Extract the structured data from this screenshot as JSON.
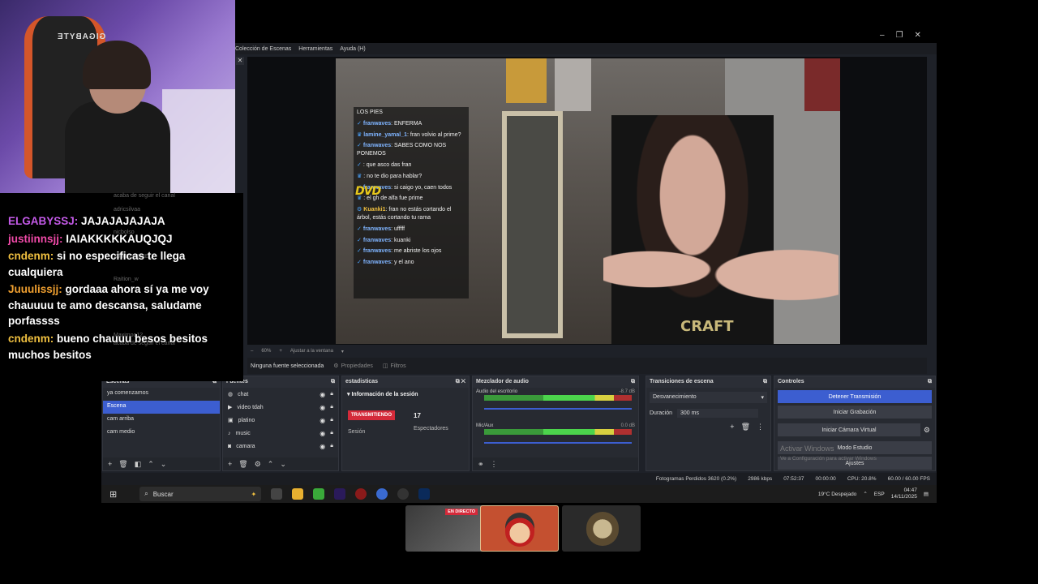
{
  "webcam": {
    "chair_brand": "GIGABYTE"
  },
  "window": {
    "controls": [
      "–",
      "❐",
      "✕"
    ]
  },
  "menubar": {
    "items": [
      "Colección de Escenas",
      "Herramientas",
      "Ayuda (H)"
    ]
  },
  "preview": {
    "overlay_chat": [
      {
        "user": "",
        "text": "LOS PIES",
        "style": ""
      },
      {
        "user": "franwaves",
        "text": ": ENFERMA",
        "style": ""
      },
      {
        "user": "lamine_yamal_1",
        "text": ": fran volvio al prime?",
        "style": "y"
      },
      {
        "user": "franwaves",
        "text": ": SABES COMO NOS PONEMOS",
        "style": ""
      },
      {
        "user": "",
        "text": ": que asco das fran",
        "style": "r"
      },
      {
        "user": "",
        "text": ": no te dio para hablar?",
        "style": "y"
      },
      {
        "user": "franwaves",
        "text": ": si caigo yo, caen todos",
        "style": ""
      },
      {
        "user": "",
        "text": ": el gh de alfa fue prime",
        "style": "r"
      },
      {
        "user": "Kuanki1",
        "text": ": fran no estás cortando el árbol, estás cortando tu rama",
        "style": "y"
      },
      {
        "user": "franwaves",
        "text": ": ufffff",
        "style": ""
      },
      {
        "user": "franwaves",
        "text": ": kuanki",
        "style": ""
      },
      {
        "user": "franwaves",
        "text": ": me abriste los ojos",
        "style": ""
      },
      {
        "user": "franwaves",
        "text": ": y el ano",
        "style": ""
      }
    ],
    "dvd_logo": "DVD",
    "shirt_text": "CRAFT",
    "zoom": "60%",
    "zoom_fit": "Ajustar a la ventana"
  },
  "sourcebar": {
    "status": "Ninguna fuente seleccionada",
    "properties": "Propiedades",
    "filters": "Filtros"
  },
  "scenes": {
    "title": "Escenas",
    "items": [
      "ya comenzamos",
      "Escena",
      "cam arriba",
      "cam medio"
    ],
    "selected": 1
  },
  "sources": {
    "title": "Fuentes",
    "items": [
      "chat",
      "video tdah",
      "platino",
      "music",
      "camara"
    ]
  },
  "stats": {
    "title": "estadisticas",
    "section": "Información de la sesión",
    "live_badge": "TRANSMITIENDO",
    "session_label": "Sesión",
    "viewers_count": "17",
    "viewers_label": "Espectadores"
  },
  "mixer": {
    "title": "Mezclador de audio",
    "channels": [
      {
        "name": "Audio del escritorio",
        "db": "-8.7 dB"
      },
      {
        "name": "Mic/Aux",
        "db": "0.0 dB"
      }
    ],
    "scale": "-60 -55 -50 -45 -40 -35 -30 -25 -20 -15 -10 -5 0"
  },
  "transitions": {
    "title": "Transiciones de escena",
    "type": "Desvanecimiento",
    "duration_label": "Duración",
    "duration_value": "300 ms"
  },
  "controls": {
    "title": "Controles",
    "buttons": [
      "Detener Transmisión",
      "Iniciar Grabación",
      "Iniciar Cámara Virtual",
      "Modo Estudio",
      "Ajustes"
    ]
  },
  "watermark": {
    "line1": "Activar Windows",
    "line2": "Ve a Configuración para activar Windows"
  },
  "statusbar": {
    "dropped": "Fotogramas Perdidos 3620 (0.2%)",
    "bitrate": "2986 kbps",
    "live_time": "07:52:37",
    "rec_time": "00:00:00",
    "cpu": "CPU: 20.8%",
    "fps": "60.00 / 60.00 FPS"
  },
  "taskbar": {
    "search": "Buscar",
    "weather": "19°C  Despejado",
    "lang": "ESP",
    "time": "04:47",
    "date": "14/11/2025"
  },
  "side_chat": [
    {
      "user": "ELGABYSSJ:",
      "text": " JAJAJAJAJAJA",
      "cls": "n1"
    },
    {
      "user": "justiinnsjj:",
      "text": " IAIAKKKKKAUQJQJ",
      "cls": "n2"
    },
    {
      "user": "cndenm:",
      "text": " si no especificas te llega cualquiera",
      "cls": "n3"
    },
    {
      "user": "Juuulissjj:",
      "text": " gordaaa ahora sí ya me voy chauuuu te amo descansa, saludame porfassss",
      "cls": "n4"
    },
    {
      "user": "cndenm:",
      "text": " bueno chauuu besos besitos muchos besitos",
      "cls": "n3"
    }
  ],
  "side_chat_ghost": [
    "acaba de seguir el canal",
    "adricsilvaa",
    "nicbolso",
    "XJIMMYGDIEL",
    "Raition_w",
    "Maximoo12",
    "acaba de seguir el canal"
  ],
  "thumbs": {
    "live_badge": "EN DIRECTO"
  },
  "colors": {
    "accent": "#3c5ed0",
    "live": "#d42a3a",
    "bg": "#1e2128"
  }
}
